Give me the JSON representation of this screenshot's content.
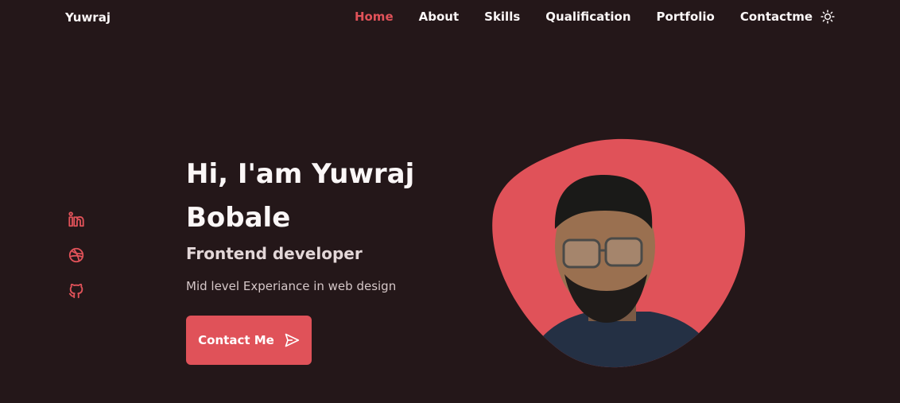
{
  "brand": {
    "name": "Yuwraj"
  },
  "nav": {
    "items": [
      {
        "label": "Home",
        "active": true
      },
      {
        "label": "About",
        "active": false
      },
      {
        "label": "Skills",
        "active": false
      },
      {
        "label": "Qualification",
        "active": false
      },
      {
        "label": "Portfolio",
        "active": false
      },
      {
        "label": "Contactme",
        "active": false
      }
    ],
    "theme_icon": "sun-icon"
  },
  "social": {
    "icons": [
      "linkedin-icon",
      "dribbble-icon",
      "github-icon"
    ]
  },
  "hero": {
    "title": "Hi, I'am Yuwraj Bobale",
    "subtitle": "Frontend developer",
    "description": "Mid level Experiance in web design",
    "cta_label": "Contact Me",
    "cta_icon": "send-icon"
  },
  "colors": {
    "background": "#241719",
    "accent": "#e05259",
    "text": "#fbf7f7"
  }
}
